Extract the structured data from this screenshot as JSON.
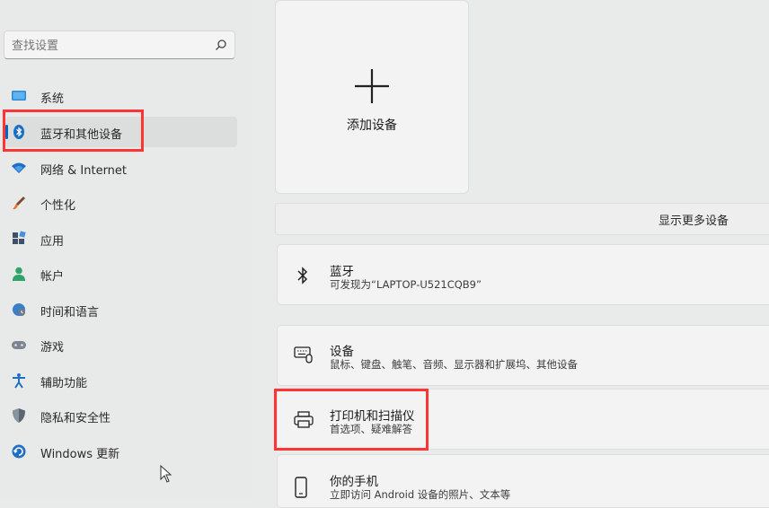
{
  "search": {
    "placeholder": "查找设置"
  },
  "sidebar": {
    "items": [
      {
        "label": "系统",
        "icon": "monitor-icon"
      },
      {
        "label": "蓝牙和其他设备",
        "icon": "bluetooth-icon",
        "active": true
      },
      {
        "label": "网络 & Internet",
        "icon": "wifi-icon"
      },
      {
        "label": "个性化",
        "icon": "brush-icon"
      },
      {
        "label": "应用",
        "icon": "apps-icon"
      },
      {
        "label": "帐户",
        "icon": "person-icon"
      },
      {
        "label": "时间和语言",
        "icon": "globe-clock-icon"
      },
      {
        "label": "游戏",
        "icon": "gamepad-icon"
      },
      {
        "label": "辅助功能",
        "icon": "accessibility-icon"
      },
      {
        "label": "隐私和安全性",
        "icon": "shield-icon"
      },
      {
        "label": "Windows 更新",
        "icon": "update-icon"
      }
    ]
  },
  "main": {
    "add_device": {
      "label": "添加设备",
      "icon": "plus-icon"
    },
    "show_more": "显示更多设备",
    "rows": [
      {
        "title": "蓝牙",
        "subtitle": "可发现为“LAPTOP-U521CQB9”",
        "icon": "bluetooth-icon"
      },
      {
        "title": "设备",
        "subtitle": "鼠标、键盘、触笔、音频、显示器和扩展坞、其他设备",
        "icon": "keyboard-mouse-icon"
      },
      {
        "title": "打印机和扫描仪",
        "subtitle": "首选项、疑难解答",
        "icon": "printer-icon"
      },
      {
        "title": "你的手机",
        "subtitle": "立即访问 Android 设备的照片、文本等",
        "icon": "phone-icon"
      }
    ]
  },
  "colors": {
    "accent": "#0067c0",
    "highlight": "#ff3434"
  }
}
